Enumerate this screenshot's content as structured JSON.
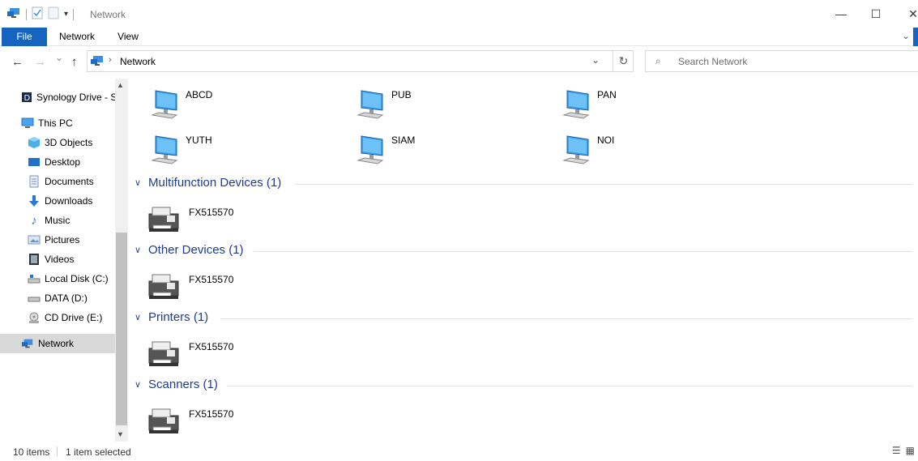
{
  "window": {
    "title": "Network",
    "minimize_glyph": "—",
    "maximize_glyph": "☐",
    "close_glyph": "✕"
  },
  "ribbon": {
    "tabs": [
      {
        "label": "File",
        "active": true
      },
      {
        "label": "Network"
      },
      {
        "label": "View"
      }
    ]
  },
  "navbar": {
    "back_glyph": "←",
    "forward_glyph": "→",
    "recent_glyph": "⌄",
    "up_glyph": "↑",
    "breadcrumb": "Network",
    "search_placeholder": "Search Network"
  },
  "sidebar": {
    "items": [
      {
        "label": "Synology Drive - S",
        "icon": "synology-drive-icon"
      },
      {
        "label": "This PC",
        "icon": "this-pc-icon"
      },
      {
        "label": "3D Objects",
        "icon": "3d-objects-icon"
      },
      {
        "label": "Desktop",
        "icon": "desktop-folder-icon"
      },
      {
        "label": "Documents",
        "icon": "documents-icon"
      },
      {
        "label": "Downloads",
        "icon": "downloads-icon"
      },
      {
        "label": "Music",
        "icon": "music-icon"
      },
      {
        "label": "Pictures",
        "icon": "pictures-icon"
      },
      {
        "label": "Videos",
        "icon": "videos-icon"
      },
      {
        "label": "Local Disk (C:)",
        "icon": "local-disk-icon"
      },
      {
        "label": "DATA (D:)",
        "icon": "data-drive-icon"
      },
      {
        "label": "CD Drive (E:)",
        "icon": "cd-drive-icon"
      },
      {
        "label": "Network",
        "icon": "network-icon",
        "selected": true
      }
    ]
  },
  "content": {
    "computers": [
      "ABCD",
      "PUB",
      "PAN",
      "YUTH",
      "SIAM",
      "NOI"
    ],
    "groups": [
      {
        "title": "Multifunction Devices (1)",
        "devices": [
          "FX515570"
        ]
      },
      {
        "title": "Other Devices (1)",
        "devices": [
          "FX515570"
        ]
      },
      {
        "title": "Printers (1)",
        "devices": [
          "FX515570"
        ]
      },
      {
        "title": "Scanners (1)",
        "devices": [
          "FX515570"
        ]
      }
    ]
  },
  "status": {
    "item_count": "10 items",
    "selection": "1 item selected"
  },
  "colors": {
    "accent": "#1565c0",
    "group_header": "#1f3d8c"
  }
}
